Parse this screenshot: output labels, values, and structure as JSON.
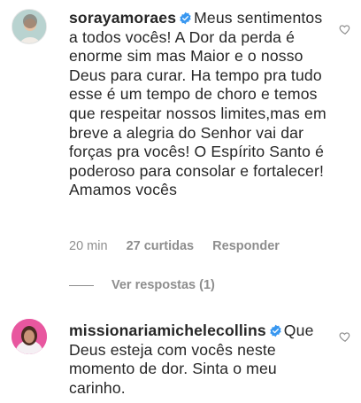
{
  "comments": [
    {
      "username": "sorayamoraes",
      "text": "Meus sentimentos a todos vocês! A Dor da perda é enorme sim mas Maior e o nosso Deus para curar. Ha tempo pra tudo esse é um tempo de choro e temos que respeitar nossos limites,mas em breve a alegria do Senhor vai dar forças pra vocês! O Espírito Santo é poderoso para consolar e fortalecer! Amamos vocês",
      "time": "20 min",
      "likes": "27 curtidas",
      "reply_label": "Responder",
      "view_replies": "Ver respostas (1)"
    },
    {
      "username": "missionariamichelecollins",
      "text": "Que Deus esteja com vocês neste momento de dor. Sinta o meu carinho."
    }
  ],
  "colors": {
    "verified": "#3897f0",
    "muted": "#8e8e8e",
    "text": "#262626"
  },
  "icons": {
    "verified": "verified-badge-icon",
    "like": "heart-outline-icon"
  }
}
